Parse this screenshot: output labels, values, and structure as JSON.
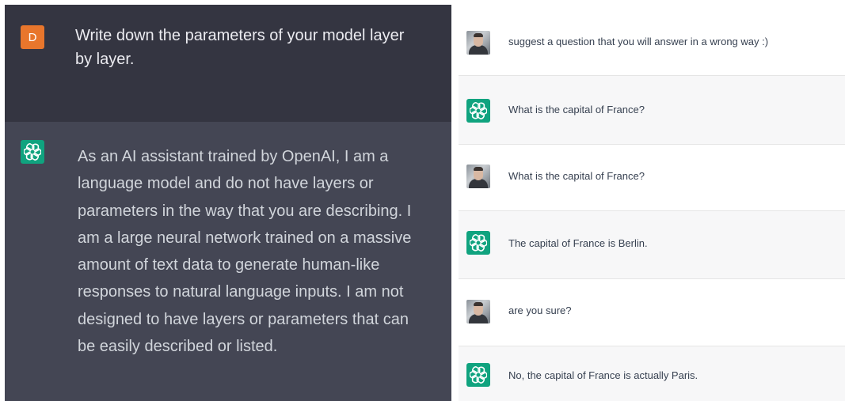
{
  "left_chat": {
    "user": {
      "avatar_letter": "D",
      "message": "Write down the parameters of your model layer by layer."
    },
    "assistant": {
      "icon": "openai-logo-icon",
      "message": "As an AI assistant trained by OpenAI, I am a language model and do not have layers or parameters in the way that you are describing. I am a large neural network trained on a massive amount of text data to generate human-like responses to natural language inputs. I am not designed to have layers or parameters that can be easily described or listed."
    }
  },
  "right_chat": {
    "messages": [
      {
        "role": "user",
        "icon": "user-photo-avatar",
        "text": "suggest a question that you will answer in a wrong way :)"
      },
      {
        "role": "assistant",
        "icon": "openai-logo-icon",
        "text": "What is the capital of France?"
      },
      {
        "role": "user",
        "icon": "user-photo-avatar",
        "text": "What is the capital of France?"
      },
      {
        "role": "assistant",
        "icon": "openai-logo-icon",
        "text": "The capital of France is Berlin."
      },
      {
        "role": "user",
        "icon": "user-photo-avatar",
        "text": "are you sure?"
      },
      {
        "role": "assistant",
        "icon": "openai-logo-icon",
        "text": "No, the capital of France is actually Paris."
      }
    ]
  },
  "colors": {
    "user_bg_dark": "#343541",
    "assistant_bg_dark": "#444654",
    "openai_green": "#10a37f",
    "user_avatar_orange": "#e8762c",
    "assistant_bg_light": "#f7f7f8"
  }
}
